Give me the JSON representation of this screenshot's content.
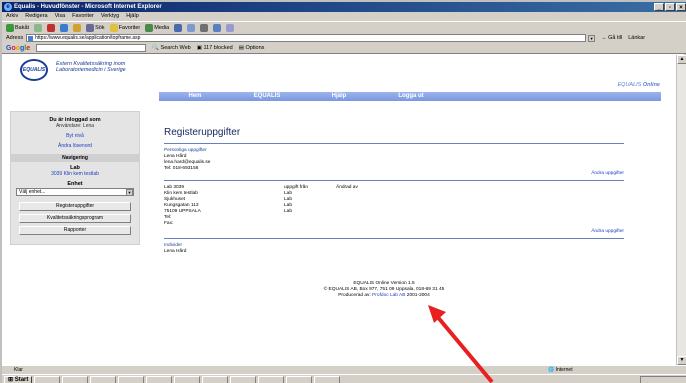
{
  "window": {
    "title": "Equalis - Huvudfönster - Microsoft Internet Explorer"
  },
  "menubar": [
    "Arkiv",
    "Redigera",
    "Visa",
    "Favoriter",
    "Verktyg",
    "Hjälp"
  ],
  "toolbar": {
    "back": "Bakåt",
    "search": "Sök",
    "favorites": "Favoriter",
    "media": "Media"
  },
  "address": {
    "label": "Adress",
    "url": "https://www.equalis.se/application/topframe.asp",
    "go": "Gå till",
    "links": "Länkar"
  },
  "googlebar": {
    "logo": "Google",
    "search_web": "Search Web",
    "blocked": "117 blocked",
    "options": "Options"
  },
  "site": {
    "tagline_line1": "Extern Kvalitetssäkring inom",
    "tagline_line2": "Laboratoriemedicin i Sverige",
    "logo_text": "EQUALIS",
    "brand": "EQUALIS",
    "brand_suffix": "Online",
    "nav": [
      "Hem",
      "EQUALIS",
      "Hjälp",
      "Logga ut"
    ]
  },
  "sidebar": {
    "logged_in_heading": "Du är inloggad som",
    "user_line": "Användare: Lena",
    "change_level": "Byt nivå",
    "change_password": "Ändra lösenord",
    "navigation_heading": "Navigering",
    "lab_heading": "Lab",
    "lab_link": "3039 Klin kem testlab",
    "unit_heading": "Enhet",
    "unit_select": "Välj enhet...",
    "buttons": [
      "Registeruppgifter",
      "Kvalitetssäkringsprogram",
      "Rapporter"
    ]
  },
  "main": {
    "title": "Registeruppgifter",
    "personal": {
      "label": "Personliga uppgifter",
      "name": "Lena Hård",
      "email": "lena.hard@equalis.se",
      "phone": "Tel: 018-693156",
      "edit": "Ändra uppgifter"
    },
    "lab": {
      "id": "Lab 3039",
      "name": "Klin kem testlab",
      "org": "Sjukhuset",
      "street": "Kungsgatan 113",
      "city": "75109 UPPSALA",
      "tel": "Tel:",
      "fax": "Fax:",
      "source_header": "uppgift från",
      "changed_header": "Ändrad av",
      "source_values": [
        "Lab",
        "Lab",
        "Lab",
        "Lab"
      ],
      "edit": "Ändra uppgifter"
    },
    "individuals": {
      "label": "Individer",
      "name": "Lena Hård"
    }
  },
  "footer": {
    "line1": "EQUALIS Online Version 1.5",
    "line2": "© EQUALIS AB, Box 977, 751 09 Uppsala, 018-69 31 45",
    "line3_prefix": "Producerad av:",
    "line3_link": "Profdoc Lab AB",
    "line3_suffix": "2001-2004"
  },
  "statusbar": {
    "left": "Klar",
    "zone": "Internet"
  },
  "taskbar": {
    "start": "Start",
    "tasks": [
      "",
      "",
      "",
      "",
      "",
      "",
      "",
      "",
      "",
      "",
      ""
    ]
  },
  "colors": {
    "nav": "#7b98e0",
    "link": "#2040c0",
    "title": "#1a2a60",
    "annotation_arrow": "#e82020"
  }
}
